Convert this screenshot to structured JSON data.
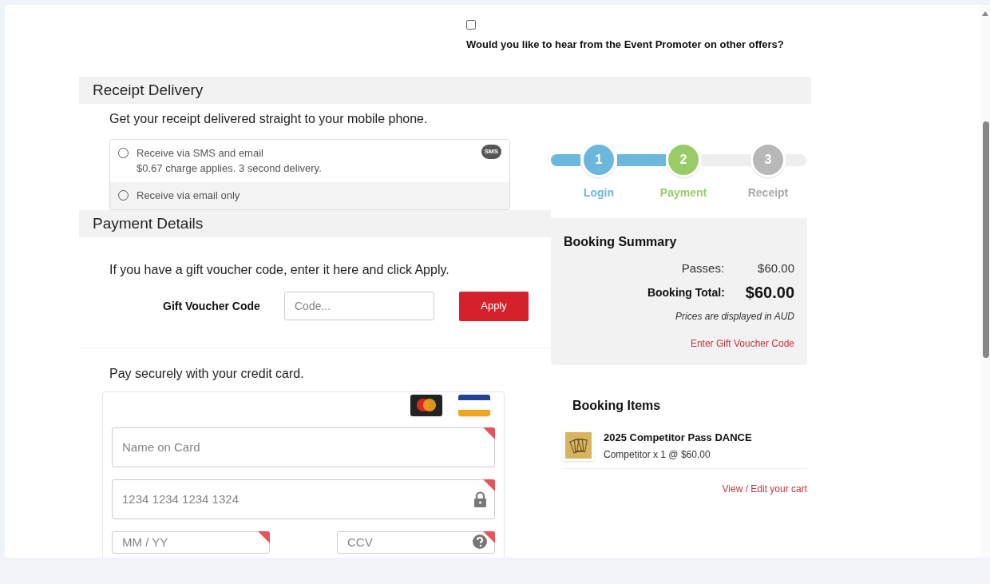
{
  "promoter_optin": {
    "checked": false,
    "label": "Would you like to hear from the Event Promoter on other offers?"
  },
  "receipt_delivery": {
    "heading": "Receipt Delivery",
    "intro": "Get your receipt delivered straight to your mobile phone.",
    "options": [
      {
        "label": "Receive via SMS and email",
        "note": "$0.67 charge applies. 3 second delivery.",
        "badge": "SMS",
        "selected": false
      },
      {
        "label": "Receive via email only",
        "selected": false
      }
    ]
  },
  "payment_details": {
    "heading": "Payment Details",
    "voucher_intro": "If you have a gift voucher code, enter it here and click Apply.",
    "voucher_label": "Gift Voucher Code",
    "voucher_placeholder": "Code...",
    "apply_button": "Apply",
    "card_intro": "Pay securely with your credit card.",
    "card_fields": [
      {
        "kind": "name",
        "placeholder": "Name on Card"
      },
      {
        "kind": "number",
        "placeholder": "1234 1234 1234 1324"
      },
      {
        "kind": "expiry",
        "placeholder": "MM / YY"
      },
      {
        "kind": "ccv",
        "placeholder": "CCV"
      }
    ]
  },
  "steps": [
    {
      "number": "1",
      "label": "Login",
      "completed": true,
      "selected": false
    },
    {
      "number": "2",
      "label": "Payment",
      "completed": false,
      "selected": true
    },
    {
      "number": "3",
      "label": "Receipt",
      "completed": false,
      "selected": false
    }
  ],
  "booking_summary": {
    "title": "Booking Summary",
    "passes_label": "Passes:",
    "passes_value": "$60.00",
    "total_label": "Booking Total:",
    "total_value": "$60.00",
    "currency_note": "Prices are displayed in AUD",
    "voucher_link": "Enter Gift Voucher Code"
  },
  "booking_items": {
    "title": "Booking Items",
    "items": [
      {
        "name": "2025 Competitor Pass DANCE",
        "detail": "Competitor x 1 @ $60.00"
      }
    ],
    "cart_link": "View / Edit your cart"
  }
}
